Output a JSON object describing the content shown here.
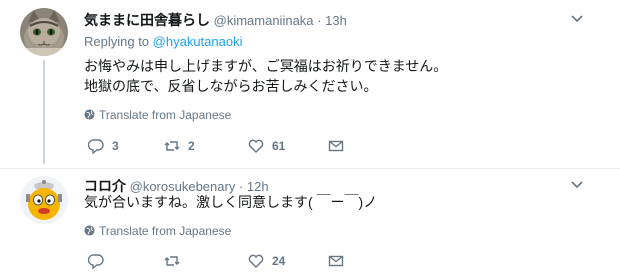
{
  "tweets": [
    {
      "name": "気ままに田舎暮らし",
      "handle": "@kimamaniinaka",
      "separator": "·",
      "time": "13h",
      "replying_prefix": "Replying to",
      "replying_to": "@hyakutanaoki",
      "text_lines": [
        "お悔やみは申し上げますが、ご冥福はお祈りできません。",
        "地獄の底で、反省しながらお苦しみください。"
      ],
      "translate": "Translate from Japanese",
      "actions": {
        "reply_count": "3",
        "retweet_count": "2",
        "like_count": "61"
      },
      "icons": [
        "cat-avatar",
        "caret-down-icon",
        "globe-icon",
        "reply-icon",
        "retweet-icon",
        "heart-icon",
        "message-icon"
      ]
    },
    {
      "name": "コロ介",
      "handle": "@korosukebenary",
      "separator": "·",
      "time": "12h",
      "text_lines": [
        "気が合いますね。激しく同意します( ￣ー￣)ノ"
      ],
      "translate": "Translate from Japanese",
      "actions": {
        "reply_count": "",
        "retweet_count": "",
        "like_count": "24"
      },
      "icons": [
        "korosuke-avatar",
        "caret-down-icon",
        "globe-icon",
        "reply-icon",
        "retweet-icon",
        "heart-icon",
        "message-icon"
      ]
    }
  ],
  "colors": {
    "link": "#1da1f2",
    "secondary": "#657786",
    "thread_line": "#ccd6dd"
  }
}
